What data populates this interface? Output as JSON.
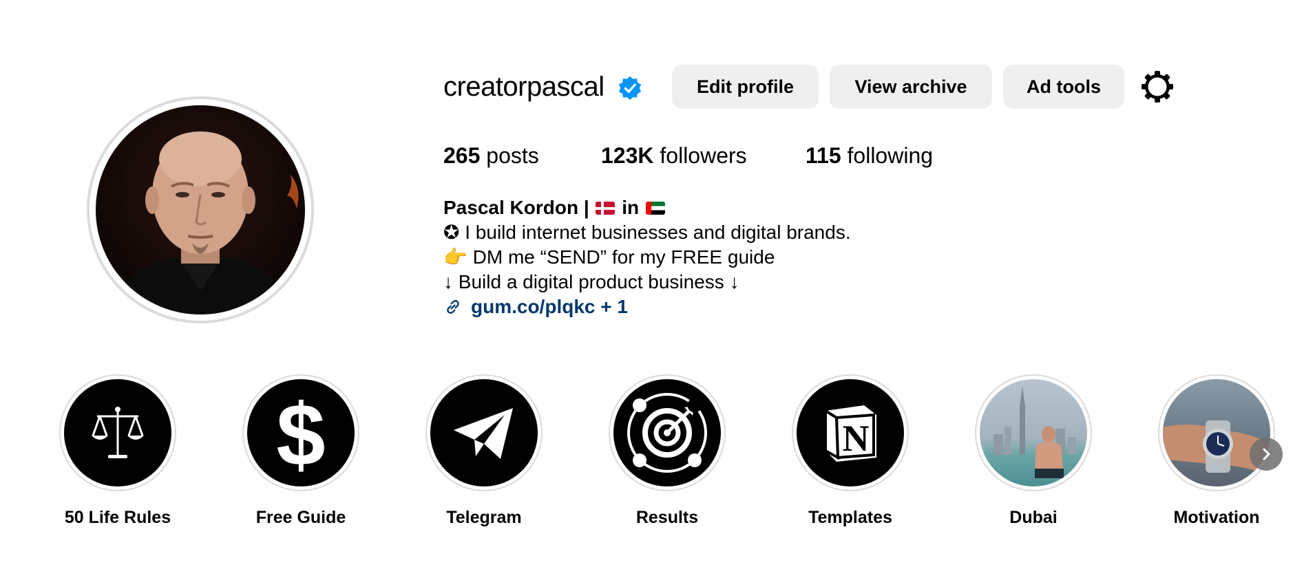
{
  "profile": {
    "username": "creatorpascal",
    "verified_icon": "verified-badge-icon",
    "buttons": {
      "edit": "Edit profile",
      "archive": "View archive",
      "ad_tools": "Ad tools"
    },
    "settings_icon": "gear-icon"
  },
  "stats": {
    "posts_count": "265",
    "posts_label": " posts",
    "followers_count": "123K",
    "followers_label": " followers",
    "following_count": "115",
    "following_label": " following"
  },
  "bio": {
    "name_part1": "Pascal Kordon | ",
    "name_part2": " in ",
    "line1": "✪ I build internet businesses and digital brands.",
    "line2_emoji": "👉",
    "line2": " DM me “SEND” for my FREE guide",
    "line3": "↓ Build a digital product business ↓",
    "link": "gum.co/plqkc + 1",
    "link_icon": "link-icon"
  },
  "highlights": [
    {
      "label": "50 Life Rules",
      "icon": "scales-icon"
    },
    {
      "label": "Free Guide",
      "icon": "dollar-icon"
    },
    {
      "label": "Telegram",
      "icon": "telegram-icon"
    },
    {
      "label": "Results",
      "icon": "target-icon"
    },
    {
      "label": "Templates",
      "icon": "notion-icon"
    },
    {
      "label": "Dubai",
      "icon": "dubai-photo"
    },
    {
      "label": "Motivation",
      "icon": "watch-photo"
    }
  ],
  "colors": {
    "link": "#00376b",
    "verified": "#0095f6",
    "button_bg": "#efefef"
  }
}
